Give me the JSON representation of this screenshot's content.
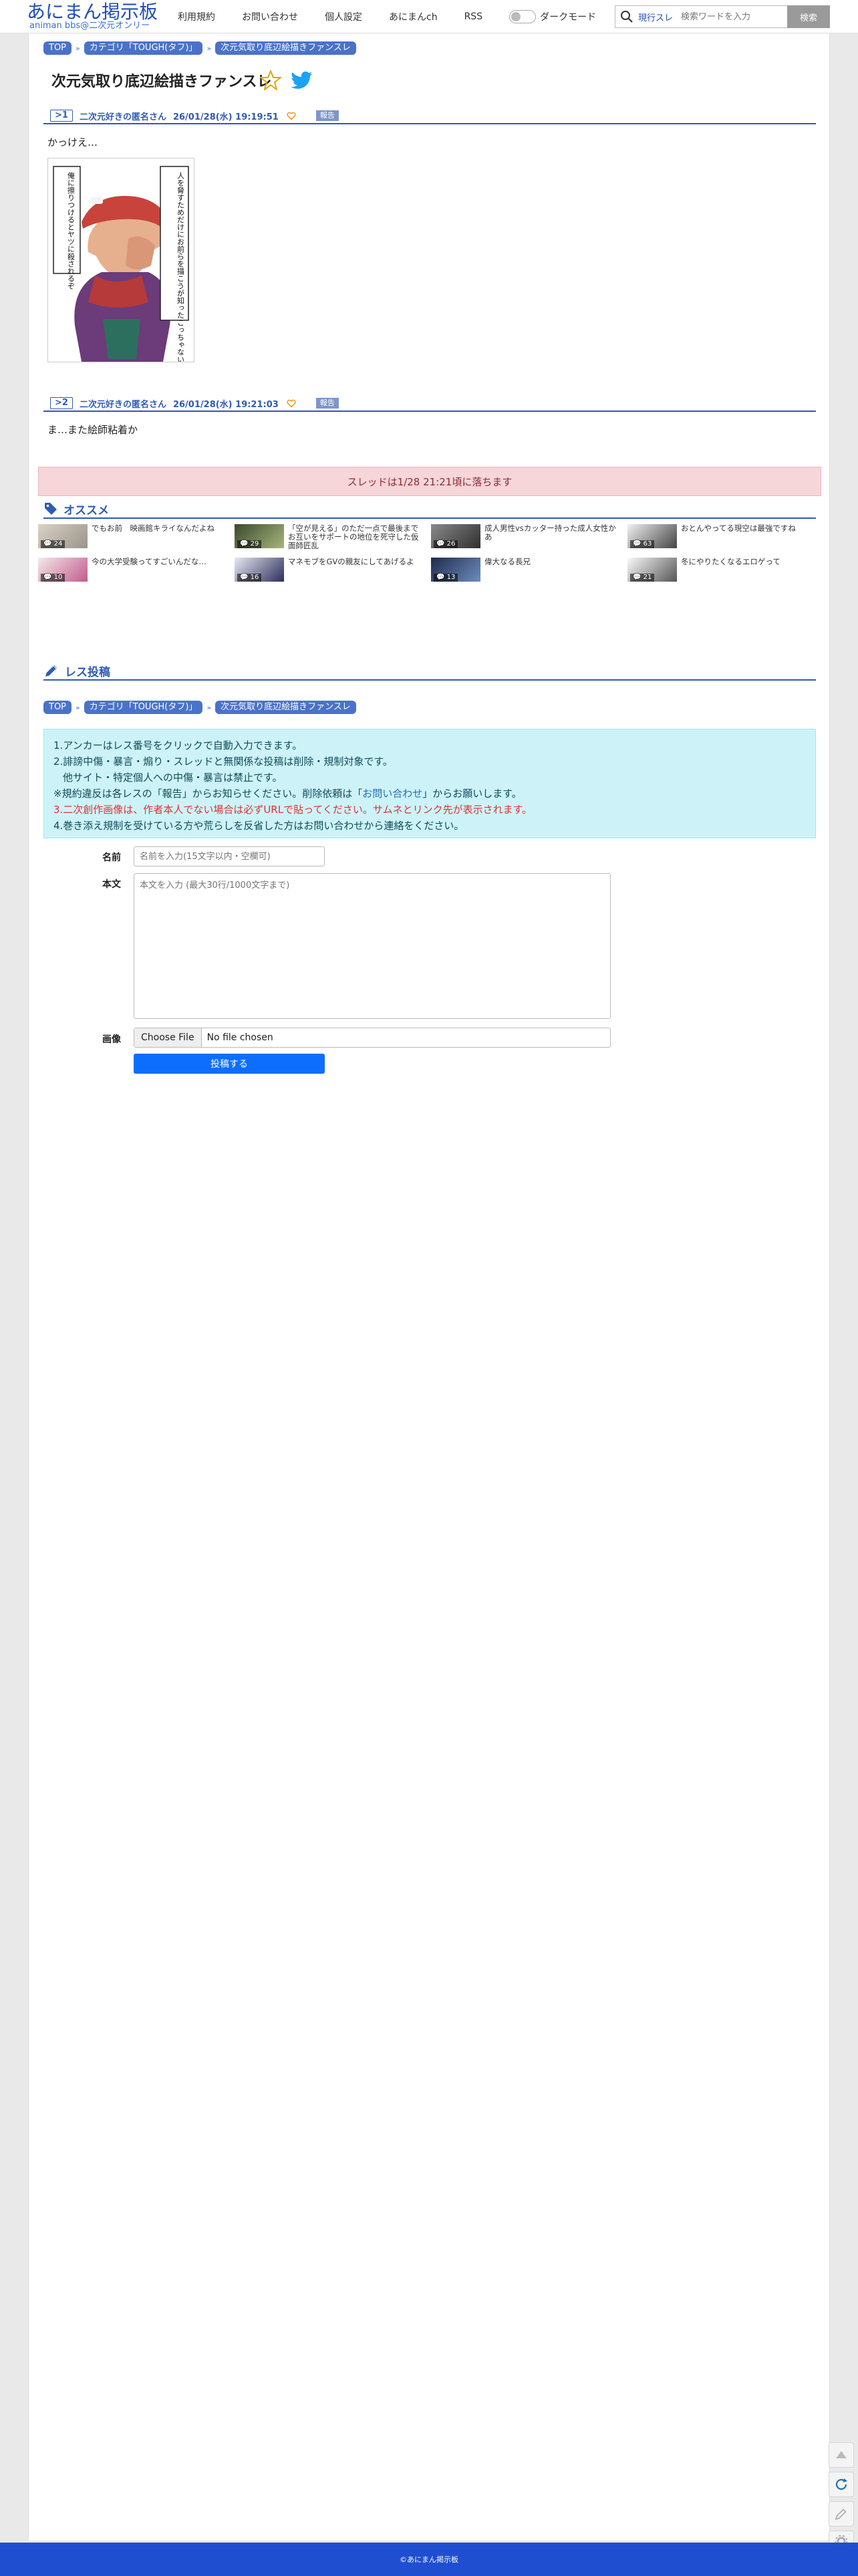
{
  "header": {
    "logo_ja": "あにまん掲示板",
    "logo_en": "animan bbs@二次元オンリー",
    "nav": [
      {
        "label": "利用規約"
      },
      {
        "label": "お問い合わせ"
      },
      {
        "label": "個人設定"
      },
      {
        "label": "あにまんch"
      },
      {
        "label": "RSS"
      }
    ],
    "dark_mode_label": "ダークモード",
    "search_mode": "現行スレ",
    "search_placeholder": "検索ワードを入力",
    "search_button": "検索"
  },
  "breadcrumb": [
    "TOP",
    "カテゴリ「TOUGH(タフ)」",
    "次元気取り底辺絵描きファンスレ"
  ],
  "thread": {
    "title": "次元気取り底辺絵描きファンスレ"
  },
  "posts": [
    {
      "number": ">1",
      "name": "二次元好きの匿名さん",
      "date": "26/01/28(水) 19:19:51",
      "report": "報告",
      "body": "かっけえ…",
      "image_caption_right": "人を脅すためだけにお前らを描こうが知ったこっちゃないが",
      "image_caption_left": "俺に擦りつけるとヤツに殺されるぞ"
    },
    {
      "number": ">2",
      "name": "二次元好きの匿名さん",
      "date": "26/01/28(水) 19:21:03",
      "report": "報告",
      "body": "ま…また絵師粘着か"
    }
  ],
  "drop_notice": "スレッドは1/28 21:21頃に落ちます",
  "recommend": {
    "title": "オススメ",
    "items": [
      {
        "title": "でもお前　映画館キライなんだよね",
        "count": "24"
      },
      {
        "title": "「空が見える」のただ一点で最後までお互いをサポートの地位を死守した仮面師匠乱",
        "count": "29"
      },
      {
        "title": "成人男性vsカッター持った成人女性かあ",
        "count": "26"
      },
      {
        "title": "おとんやってる現空は最強ですね",
        "count": "63"
      },
      {
        "title": "今の大学受験ってすごいんだな…",
        "count": "10"
      },
      {
        "title": "マネモブをGVの親友にしてあげるよ",
        "count": "16"
      },
      {
        "title": "偉大なる長兄",
        "count": "13"
      },
      {
        "title": "冬にやりたくなるエロゲって",
        "count": "21"
      }
    ]
  },
  "post_form": {
    "title": "レス投稿",
    "rules": [
      "1.アンカーはレス番号をクリックで自動入力できます。",
      "2.誹謗中傷・暴言・煽り・スレッドと無関係な投稿は削除・規制対象です。",
      "他サイト・特定個人への中傷・暴言は禁止です。",
      "※規約違反は各レスの「報告」からお知らせください。削除依頼は「",
      "お問い合わせ",
      "」からお願いします。",
      "3.二次創作画像は、作者本人でない場合は必ずURLで貼ってください。サムネとリンク先が表示されます。",
      "4.巻き添え規制を受けている方や荒らしを反省した方はお問い合わせから連絡をください。"
    ],
    "name_label": "名前",
    "name_placeholder": "名前を入力(15文字以内・空欄可)",
    "body_label": "本文",
    "body_placeholder": "本文を入力 (最大30行/1000文字まで)",
    "image_label": "画像",
    "file_button": "Choose File",
    "file_status": "No file chosen",
    "submit": "投稿する"
  },
  "footer": {
    "copyright": "©あにまん掲示板"
  },
  "colors": {
    "brand_blue": "#1f4fb5",
    "post_header_blue": "#2f5bb5",
    "notice_pink": "#f7d6d9",
    "info_cyan": "#cdf3f8",
    "submit_blue": "#0d6efd",
    "footer_blue": "#1f4fd0"
  }
}
